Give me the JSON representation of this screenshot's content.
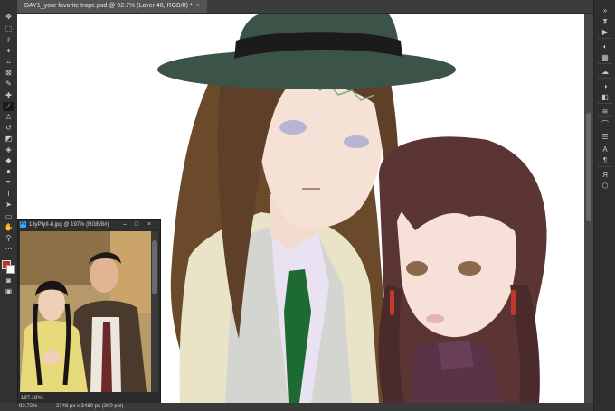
{
  "document": {
    "tab_title": "DAY1_your favorite trope.psd @ 92.7% (Layer 48, RGB/8) *",
    "tab_close": "×"
  },
  "status": {
    "zoom": "92.72%",
    "doc_info": "2748 px x 3480 px (300 ppi)"
  },
  "nav_window": {
    "title": "13yPfyII-8.jpg @ 197% (RGB/8#)",
    "app_badge": "Ps",
    "minimize": "–",
    "maximize": "□",
    "close": "×",
    "zoom": "197.18%"
  },
  "tools_left": [
    {
      "icon": "move-icon",
      "glyph": "✥"
    },
    {
      "icon": "marquee-icon",
      "glyph": "⬚"
    },
    {
      "icon": "lasso-icon",
      "glyph": "ℓ"
    },
    {
      "icon": "magic-wand-icon",
      "glyph": "✦"
    },
    {
      "icon": "crop-icon",
      "glyph": "⌗"
    },
    {
      "icon": "frame-icon",
      "glyph": "⊠"
    },
    {
      "icon": "eyedropper-icon",
      "glyph": "✎"
    },
    {
      "icon": "healing-brush-icon",
      "glyph": "✚"
    },
    {
      "icon": "brush-icon",
      "glyph": "∕"
    },
    {
      "icon": "clone-stamp-icon",
      "glyph": "♙"
    },
    {
      "icon": "history-brush-icon",
      "glyph": "↺"
    },
    {
      "icon": "eraser-icon",
      "glyph": "◩"
    },
    {
      "icon": "paint-bucket-icon",
      "glyph": "◈"
    },
    {
      "icon": "blur-icon",
      "glyph": "◆"
    },
    {
      "icon": "dodge-icon",
      "glyph": "●"
    },
    {
      "icon": "pen-icon",
      "glyph": "✒"
    },
    {
      "icon": "type-icon",
      "glyph": "T"
    },
    {
      "icon": "path-select-icon",
      "glyph": "➤"
    },
    {
      "icon": "rectangle-icon",
      "glyph": "▭"
    },
    {
      "icon": "hand-icon",
      "glyph": "✋"
    },
    {
      "icon": "zoom-icon",
      "glyph": "⚲"
    },
    {
      "icon": "more-tools-icon",
      "glyph": "⋯"
    }
  ],
  "tools_right": [
    {
      "icon": "collapse-icon",
      "glyph": "»"
    },
    {
      "icon": "history-panel-icon",
      "glyph": "⧗"
    },
    {
      "icon": "play-action-icon",
      "glyph": "▶"
    },
    {
      "icon": "color-panel-icon",
      "glyph": "◐"
    },
    {
      "icon": "swatches-panel-icon",
      "glyph": "▦"
    },
    {
      "icon": "libraries-icon",
      "glyph": "☁"
    },
    {
      "icon": "adjustments-icon",
      "glyph": "◑"
    },
    {
      "icon": "layers-icon",
      "glyph": "◧"
    },
    {
      "icon": "channels-icon",
      "glyph": "≋"
    },
    {
      "icon": "paths-icon",
      "glyph": "⌒"
    },
    {
      "icon": "properties-icon",
      "glyph": "☰"
    },
    {
      "icon": "character-icon",
      "glyph": "A"
    },
    {
      "icon": "paragraph-icon",
      "glyph": "¶"
    },
    {
      "icon": "glyphs-icon",
      "glyph": "Я"
    },
    {
      "icon": "3d-icon",
      "glyph": "⬡"
    }
  ],
  "colors": {
    "foreground": "#b23a2a",
    "background": "#ffffff"
  }
}
